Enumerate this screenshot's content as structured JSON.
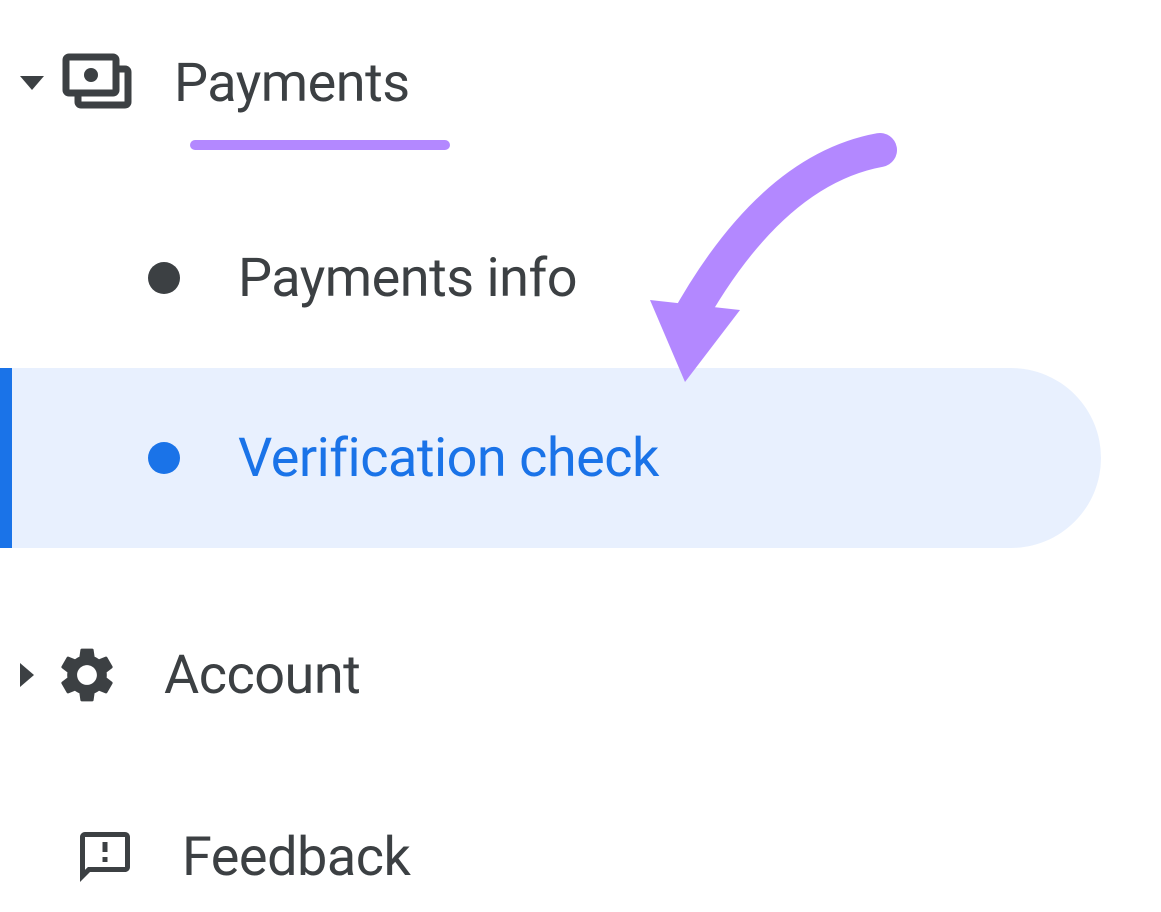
{
  "nav": {
    "payments": {
      "label": "Payments",
      "expanded": true,
      "children": [
        {
          "label": "Payments info",
          "selected": false
        },
        {
          "label": "Verification check",
          "selected": true
        }
      ]
    },
    "account": {
      "label": "Account",
      "expanded": false
    },
    "feedback": {
      "label": "Feedback"
    }
  },
  "annotation": {
    "underlineColor": "#b388ff",
    "arrowColor": "#b388ff"
  }
}
